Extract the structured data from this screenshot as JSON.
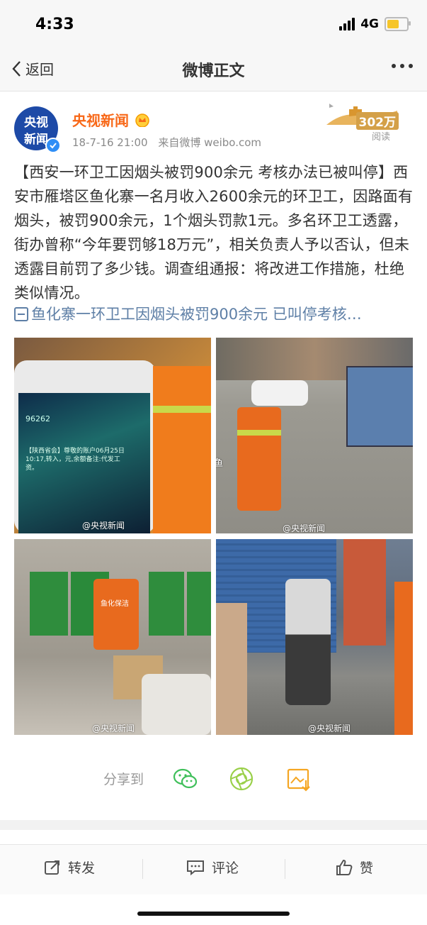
{
  "status_bar": {
    "time": "4:33",
    "network": "4G",
    "battery_color": "#f6c529"
  },
  "nav": {
    "back_label": "返回",
    "title": "微博正文"
  },
  "post": {
    "avatar_text_line1": "央视",
    "avatar_text_line2": "新闻",
    "author": "央视新闻",
    "timestamp": "18-7-16 21:00",
    "source": "来自微博 weibo.com",
    "views_count": "302万",
    "views_label": "阅读",
    "body": "【西安一环卫工因烟头被罚900余元 考核办法已被叫停】西安市雁塔区鱼化寨一名月收入2600余元的环卫工，因路面有烟头，被罚900余元，1个烟头罚款1元。多名环卫工透露，街办曾称“今年要罚够18万元”，相关负责人予以否认，但未透露目前罚了多少钱。调查组通报：将改进工作措施，杜绝类似情况。",
    "link_text": "鱼化寨一环卫工因烟头被罚900余元 已叫停考核…",
    "photos": [
      {
        "watermark": "@央视新闻",
        "phone_text_1": "96262",
        "phone_text_2": "【陕西省会】尊敬的账户06月25日10:17,转入，元,余额备注:代发工资。"
      },
      {
        "watermark": "@央视新闻",
        "watermark_extra": "@不洗澡的鱼"
      },
      {
        "watermark": "@央视新闻",
        "vest_text": "鱼化保洁"
      },
      {
        "watermark": "@央视新闻"
      }
    ],
    "brand_color": "#f86818",
    "link_color": "#5e7fa6"
  },
  "share": {
    "label": "分享到",
    "targets": [
      "wechat-icon",
      "moments-icon",
      "save-image-icon"
    ]
  },
  "actions": {
    "repost": "转发",
    "comment": "评论",
    "like": "赞"
  }
}
